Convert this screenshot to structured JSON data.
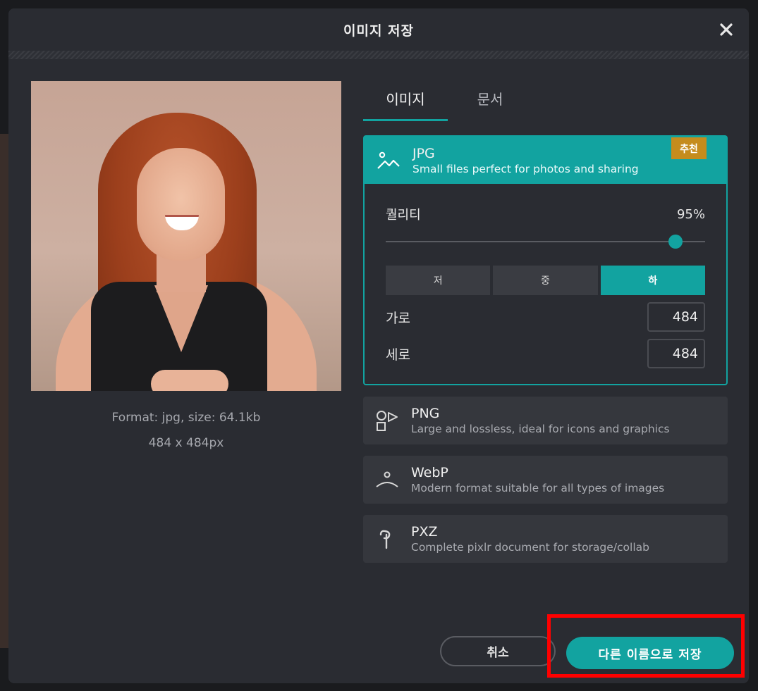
{
  "dialog": {
    "title": "이미지 저장"
  },
  "preview": {
    "format_info": "Format: jpg, size: 64.1kb",
    "dimensions_info": "484 x 484px"
  },
  "tabs": [
    {
      "label": "이미지",
      "active": true
    },
    {
      "label": "문서",
      "active": false
    }
  ],
  "formats": [
    {
      "name": "JPG",
      "desc": "Small files perfect for photos and sharing",
      "icon": "landscape-icon",
      "selected": true,
      "badge": "추천"
    },
    {
      "name": "PNG",
      "desc": "Large and lossless, ideal for icons and graphics",
      "icon": "shapes-icon",
      "selected": false
    },
    {
      "name": "WebP",
      "desc": "Modern format suitable for all types of images",
      "icon": "sun-horizon-icon",
      "selected": false
    },
    {
      "name": "PXZ",
      "desc": "Complete pixlr document for storage/collab",
      "icon": "pixlr-icon",
      "selected": false
    }
  ],
  "jpg_options": {
    "quality_label": "퀄리티",
    "quality_value": "95%",
    "quality_fraction": 0.95,
    "presets": [
      {
        "label": "저",
        "active": false
      },
      {
        "label": "중",
        "active": false
      },
      {
        "label": "하",
        "active": true
      }
    ],
    "width_label": "가로",
    "width_value": "484",
    "height_label": "세로",
    "height_value": "484"
  },
  "footer": {
    "cancel_label": "취소",
    "save_as_label": "다른 이름으로 저장"
  },
  "colors": {
    "accent": "#12a3a0",
    "badge": "#c58c1d",
    "highlight": "#ff0000",
    "dialog_bg": "#2a2c32"
  }
}
